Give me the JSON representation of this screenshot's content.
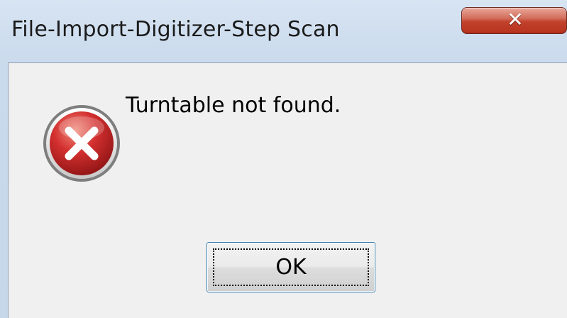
{
  "window": {
    "title": "File-Import-Digitizer-Step Scan"
  },
  "title_bar": {
    "close_icon": "close-icon",
    "close_glyph": "✕"
  },
  "dialog": {
    "icon": "error-icon",
    "message": "Turntable not found.",
    "ok_label": "OK"
  },
  "colors": {
    "client_background": "#f0f0f0",
    "close_button_red": "#c1412b",
    "error_red": "#c62828"
  }
}
